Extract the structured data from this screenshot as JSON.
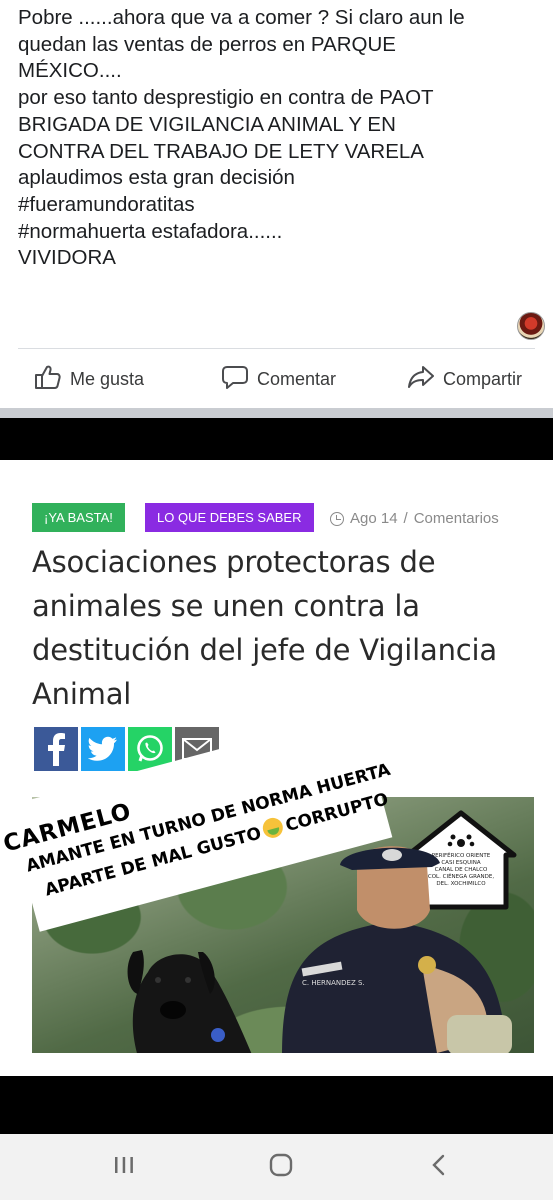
{
  "post": {
    "lines": [
      "Pobre ......ahora que va a comer ? Si claro aun le",
      "quedan las ventas de perros en PARQUE",
      "MÉXICO....",
      "por eso tanto desprestigio  en contra de PAOT",
      "BRIGADA DE VIGILANCIA ANIMAL  Y  EN",
      "CONTRA DEL TRABAJO DE LETY VARELA",
      "aplaudimos  esta gran decisión",
      "#fueramundoratitas",
      "#normahuerta estafadora......",
      "VIVIDORA"
    ],
    "actions": {
      "like": "Me gusta",
      "comment": "Comentar",
      "share": "Compartir"
    }
  },
  "article": {
    "tags": [
      "¡YA BASTA!",
      "LO QUE DEBES SABER"
    ],
    "meta": {
      "date": "Ago 14",
      "separator": "/",
      "comments": "Comentarios"
    },
    "headline_lines": [
      "Asociaciones protectoras de",
      "animales se unen contra la",
      "destitución del jefe de Vigilancia",
      "Animal"
    ],
    "share_icons": [
      "facebook-icon",
      "twitter-icon",
      "whatsapp-icon",
      "mail-icon"
    ],
    "photo": {
      "sign_lines": [
        "PERIFÉRICO ORIENTE",
        "CASI ESQUINA",
        "CANAL DE CHALCO",
        "COL. CIÉNEGA GRANDE,",
        "DEL. XOCHIMILCO"
      ],
      "badge_name": "C. HERNANDEZ S."
    }
  },
  "overlay": {
    "line1": "CARMELO",
    "line2": "AMANTE EN TURNO DE NORMA HUERTA",
    "line3_a": "APARTE DE  MAL GUSTO",
    "line3_b": "CORRUPTO"
  },
  "colors": {
    "tag_green": "#31b15b",
    "tag_purple": "#8a2be2",
    "facebook_blue": "#3b5998",
    "twitter_blue": "#1da1f2",
    "whatsapp_green": "#25d366"
  }
}
